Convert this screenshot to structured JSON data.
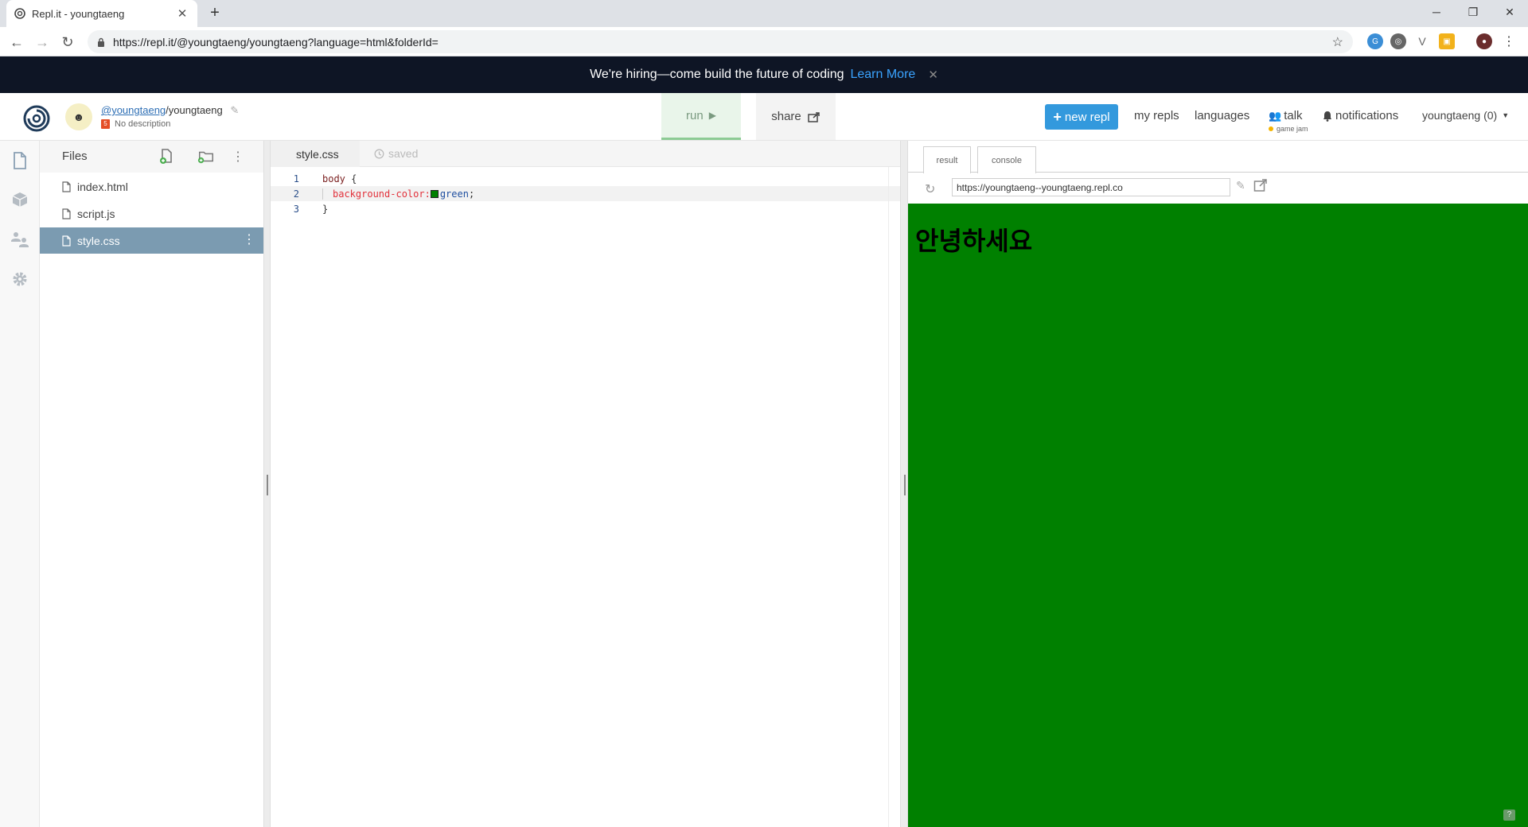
{
  "browser": {
    "tab_title": "Repl.it - youngtaeng",
    "new_tab": "+",
    "url": "https://repl.it/@youngtaeng/youngtaeng?language=html&folderId="
  },
  "banner": {
    "text": "We're hiring—come build the future of coding",
    "link": "Learn More",
    "close": "✕"
  },
  "header": {
    "owner": "@youngtaeng",
    "separator": "/",
    "repl_name": "youngtaeng",
    "description": "No description",
    "run_label": "run",
    "share_label": "share",
    "new_repl_label": "new repl",
    "my_repls": "my repls",
    "languages": "languages",
    "talk": "talk",
    "talk_sub": "game jam",
    "notifications": "notifications",
    "user_menu": "youngtaeng (0)"
  },
  "files": {
    "title": "Files",
    "items": [
      {
        "name": "index.html"
      },
      {
        "name": "script.js"
      },
      {
        "name": "style.css"
      }
    ],
    "active": "style.css"
  },
  "editor": {
    "tab": "style.css",
    "status": "saved",
    "lines": [
      {
        "num": "1",
        "selector": "body",
        "punc": " {"
      },
      {
        "num": "2",
        "prop": "background-color:",
        "value": "green",
        "end": ";"
      },
      {
        "num": "3",
        "punc": "}"
      }
    ]
  },
  "result": {
    "tabs": [
      "result",
      "console"
    ],
    "active_tab": "result",
    "url": "https://youngtaeng--youngtaeng.repl.co",
    "heading": "안녕하세요",
    "background": "#008000",
    "help": "?"
  },
  "colors": {
    "banner_bg": "#0e1525",
    "link_blue": "#3aa3ff",
    "new_repl_bg": "#3399dd",
    "active_file_bg": "#7b9bb1",
    "run_bg": "#e9f5ea"
  }
}
